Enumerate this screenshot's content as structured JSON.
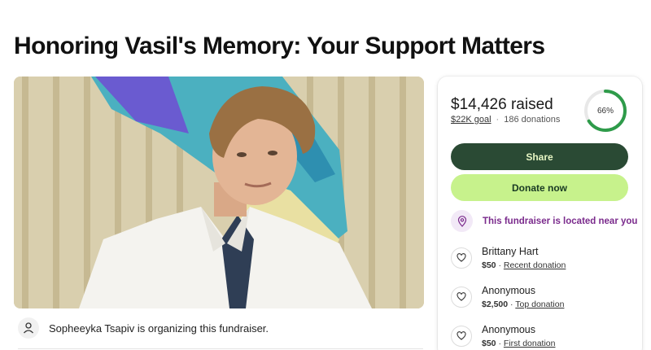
{
  "page": {
    "title": "Honoring Vasil's Memory: Your Support Matters"
  },
  "organizer": {
    "text": "Sopheeyka Tsapiv is organizing this fundraiser."
  },
  "progress": {
    "raised_amount": "$14,426",
    "raised_suffix": "raised",
    "goal_label": "$22K goal",
    "separator": "·",
    "donations_count": "186 donations",
    "percent_label": "66%",
    "percent_value": 66
  },
  "actions": {
    "share_label": "Share",
    "donate_label": "Donate now"
  },
  "location_notice": "This fundraiser is located near you",
  "donations": [
    {
      "name": "Brittany Hart",
      "amount": "$50",
      "sep": "·",
      "tag": "Recent donation"
    },
    {
      "name": "Anonymous",
      "amount": "$2,500",
      "sep": "·",
      "tag": "Top donation"
    },
    {
      "name": "Anonymous",
      "amount": "$50",
      "sep": "·",
      "tag": "First donation"
    }
  ],
  "colors": {
    "share_bg": "#2a4a34",
    "donate_bg": "#c7f28c",
    "ring_progress": "#2e9b4a",
    "ring_track": "#e8e8e8",
    "location_text": "#7a2a8c"
  },
  "icons": {
    "organizer": "person-icon",
    "location": "location-pin-icon",
    "donation": "heart-hand-icon"
  }
}
